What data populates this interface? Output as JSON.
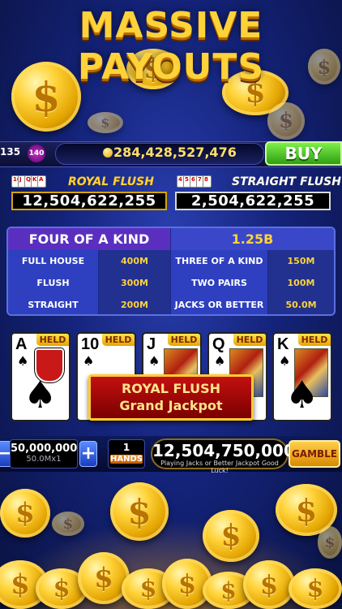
{
  "title": "MASSIVE PAYOUTS",
  "coin_symbol": "$",
  "topbar": {
    "level_text": "135",
    "level_badge": "140",
    "balance": "284,428,527,476",
    "buy_label": "BUY"
  },
  "jackpots": {
    "left": {
      "label": "ROYAL FLUSH",
      "value": "12,504,622,255",
      "mini_cards": [
        "10",
        "J",
        "Q",
        "K",
        "A"
      ]
    },
    "right": {
      "label": "STRAIGHT FLUSH",
      "value": "2,504,622,255",
      "mini_cards": [
        "4",
        "5",
        "6",
        "7",
        "8"
      ]
    }
  },
  "paytable": {
    "top": {
      "name": "FOUR OF A KIND",
      "value": "1.25B"
    },
    "rows": [
      {
        "left_name": "FULL HOUSE",
        "left_value": "400M",
        "right_name": "THREE OF A KIND",
        "right_value": "150M"
      },
      {
        "left_name": "FLUSH",
        "left_value": "300M",
        "right_name": "TWO PAIRS",
        "right_value": "100M"
      },
      {
        "left_name": "STRAIGHT",
        "left_value": "200M",
        "right_name": "JACKS OR BETTER",
        "right_value": "50.0M"
      }
    ]
  },
  "cards": [
    {
      "rank": "A",
      "suit": "♠",
      "held": "HELD"
    },
    {
      "rank": "10",
      "suit": "♠",
      "held": "HELD"
    },
    {
      "rank": "J",
      "suit": "♠",
      "held": "HELD"
    },
    {
      "rank": "Q",
      "suit": "♠",
      "held": "HELD"
    },
    {
      "rank": "K",
      "suit": "♠",
      "held": "HELD"
    }
  ],
  "banner": {
    "line1": "ROYAL FLUSH",
    "line2": "Grand Jackpot"
  },
  "controls": {
    "minus": "−",
    "plus": "+",
    "bet_value": "50,000,000",
    "bet_sub": "50.0Mx1",
    "hands_value": "1",
    "hands_label": "HANDS",
    "win_value": "12,504,750,000",
    "win_message": "Playing Jacks or Better Jackpot Good Luck!",
    "gamble_label": "GAMBLE"
  },
  "colors": {
    "gold": "#ffd23a",
    "buy_green": "#3fbf1a",
    "banner_red": "#b00000"
  }
}
